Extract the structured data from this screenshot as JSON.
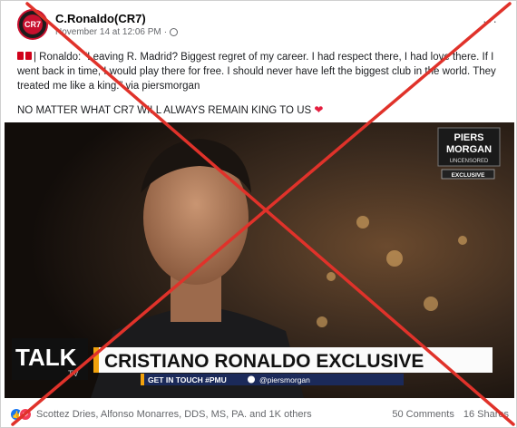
{
  "post": {
    "page_name": "C.Ronaldo(CR7)",
    "timestamp": "November 14 at 12:06 PM",
    "separator": "·",
    "more_label": "···",
    "avatar_label": "CR7",
    "caption_quote": "| Ronaldo: “Leaving R. Madrid? Biggest regret of my career. I had respect there, I had love there. If I went back in time, I would play there for free. I should never have left the biggest club in the world. They treated me like a king.” via piersmorgan",
    "caption_second": "NO MATTER WHAT CR7 WILL ALWAYS REMAIN KING TO US",
    "heart": "❤"
  },
  "video": {
    "show_line1": "PIERS",
    "show_line2": "MORGAN",
    "show_line3": "UNCENSORED",
    "exclusive_badge": "EXCLUSIVE",
    "channel_line1": "TALK",
    "channel_line2": "TV",
    "lower_third_title": "CRISTIANO RONALDO EXCLUSIVE",
    "ticker_left": "GET IN TOUCH #PMU",
    "ticker_right": "@piersmorgan"
  },
  "footer": {
    "reactors": "Scottez Dries, Alfonso Monarres, DDS, MS, PA. and 1K others",
    "comments": "50 Comments",
    "shares": "16 Shares"
  },
  "colors": {
    "cross": "#e0322a",
    "lower_third_accent": "#f2a20d",
    "badge_red": "#c8102e"
  }
}
